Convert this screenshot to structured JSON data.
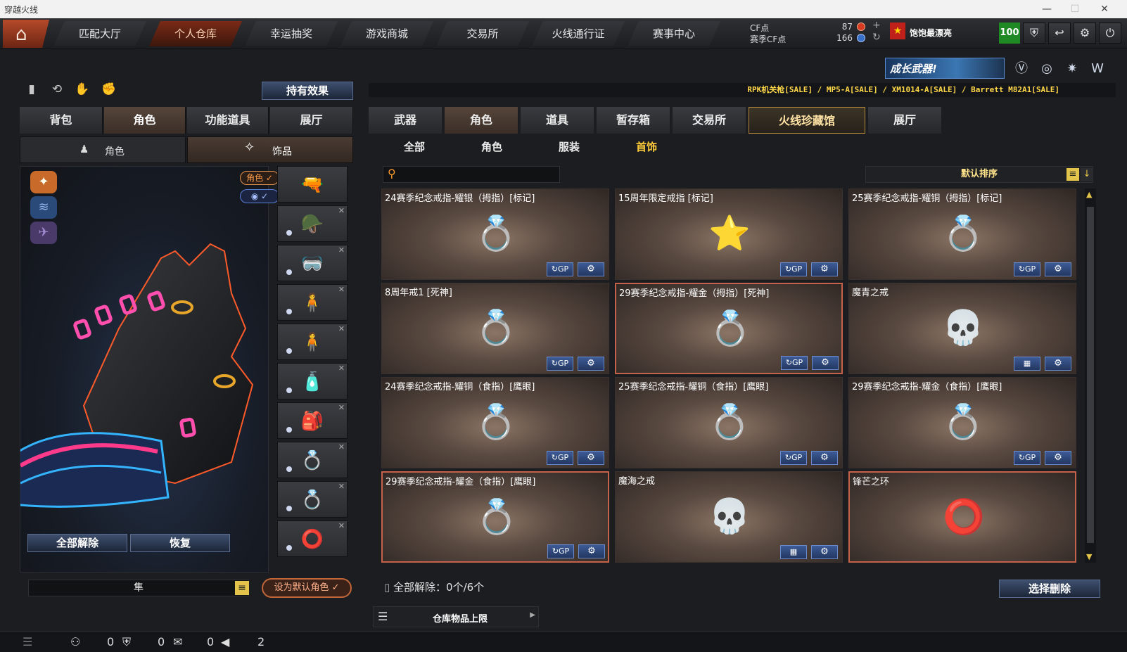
{
  "window": {
    "title": "穿越火线",
    "minimize": "—",
    "maximize": "☐",
    "close": "✕"
  },
  "nav": {
    "home_icon": "home-icon",
    "tabs": [
      "匹配大厅",
      "个人仓库",
      "幸运抽奖",
      "游戏商城",
      "交易所",
      "火线通行证",
      "赛事中心"
    ],
    "active": "个人仓库"
  },
  "currency": {
    "cf_label": "CF点",
    "cf_value": "87",
    "season_label": "赛季CF点",
    "season_value": "166"
  },
  "player": {
    "name": "饱饱最漂亮",
    "level": "100"
  },
  "banner": {
    "growth": "成长武器!"
  },
  "ticker": "RPK机关枪[SALE] / MP5-A[SALE] / XM1014-A[SALE] / Barrett M82A1[SALE]",
  "left": {
    "hold_effect": "持有效果",
    "tabs": [
      "背包",
      "角色",
      "功能道具",
      "展厅"
    ],
    "active_tab": "角色",
    "subtabs": [
      "角色",
      "饰品"
    ],
    "badge_role": "角色 ✓",
    "badge_eye": "◉ ✓",
    "unequip_all": "全部解除",
    "restore": "恢复",
    "char_name": "隼",
    "set_default": "设为默认角色 ✓"
  },
  "right": {
    "tabs": [
      "武器",
      "角色",
      "道具",
      "暂存箱",
      "交易所",
      "火线珍藏馆",
      "展厅"
    ],
    "active_tab": "角色",
    "categories": [
      "全部",
      "角色",
      "服装",
      "首饰"
    ],
    "active_category": "首饰",
    "search_placeholder": "",
    "sort_label": "默认排序",
    "items": [
      {
        "name": "24赛季纪念戒指-耀银（拇指）[标记]",
        "icon": "💍",
        "color": "#2f8a52",
        "selected": false,
        "act": "↻GP"
      },
      {
        "name": "15周年限定戒指 [标记]",
        "icon": "⭐",
        "color": "#5b8fe0",
        "selected": false,
        "act": "↻GP"
      },
      {
        "name": "25赛季纪念戒指-耀铜（拇指）[标记]",
        "icon": "💍",
        "color": "#3b66d6",
        "selected": false,
        "act": "↻GP"
      },
      {
        "name": "8周年戒1 [死神]",
        "icon": "💍",
        "color": "#d6a63a",
        "selected": false,
        "act": "↻GP"
      },
      {
        "name": "29赛季纪念戒指-耀金（拇指）[死神]",
        "icon": "💍",
        "color": "#e0a224",
        "selected": true,
        "act": "↻GP"
      },
      {
        "name": "魔青之戒",
        "icon": "💀",
        "color": "#8ab0d8",
        "selected": false,
        "act": "▦"
      },
      {
        "name": "24赛季纪念戒指-耀铜（食指）[鹰眼]",
        "icon": "💍",
        "color": "#c2402a",
        "selected": false,
        "act": "↻GP"
      },
      {
        "name": "25赛季纪念戒指-耀铜（食指）[鹰眼]",
        "icon": "💍",
        "color": "#3b66d6",
        "selected": false,
        "act": "↻GP"
      },
      {
        "name": "29赛季纪念戒指-耀金（食指）[鹰眼]",
        "icon": "💍",
        "color": "#e0a224",
        "selected": false,
        "act": "↻GP"
      },
      {
        "name": "29赛季纪念戒指-耀金（食指）[鹰眼]",
        "icon": "💍",
        "color": "#e0a224",
        "selected": true,
        "act": "↻GP"
      },
      {
        "name": "魔海之戒",
        "icon": "💀",
        "color": "#c27a3a",
        "selected": false,
        "act": "▦"
      },
      {
        "name": "锋芒之环",
        "icon": "⭕",
        "color": "#2a8ad6",
        "selected": true,
        "act": ""
      }
    ],
    "unequip_status": "全部解除：0个/6个",
    "select_delete": "选择删除",
    "warehouse_limit": "仓库物品上限"
  },
  "bottom": {
    "v1": "0",
    "v2": "0",
    "v3": "0",
    "v4": "2"
  }
}
